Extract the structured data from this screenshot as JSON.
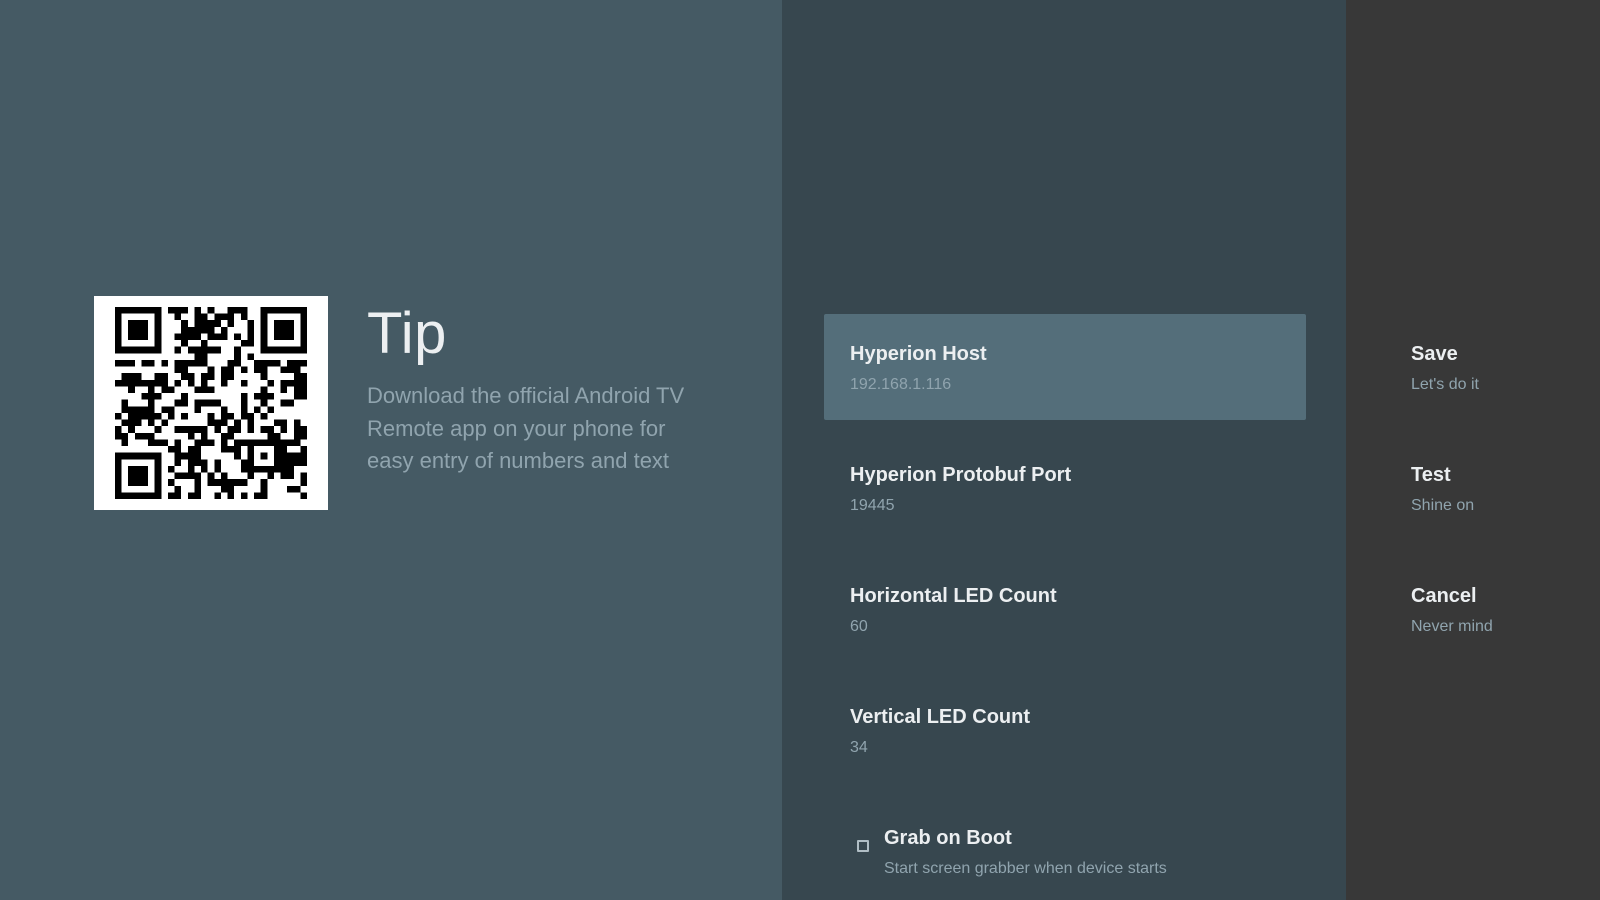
{
  "guidance": {
    "qr_icon": "qr-code-icon",
    "title": "Tip",
    "description": "Download the official Android TV Remote app on your phone for easy entry of numbers and text"
  },
  "actions": [
    {
      "title": "Hyperion Host",
      "value": "192.168.1.116",
      "focused": true
    },
    {
      "title": "Hyperion Protobuf Port",
      "value": "19445"
    },
    {
      "title": "Horizontal LED Count",
      "value": "60"
    },
    {
      "title": "Vertical LED Count",
      "value": "34"
    },
    {
      "title": "Grab on Boot",
      "description": "Start screen grabber when device starts",
      "checked": false
    }
  ],
  "buttons": [
    {
      "title": "Save",
      "description": "Let's do it"
    },
    {
      "title": "Test",
      "description": "Shine on"
    },
    {
      "title": "Cancel",
      "description": "Never mind"
    }
  ],
  "colors": {
    "guidance_bg": "#455a64",
    "actions_bg": "#37474f",
    "buttons_bg": "#383838",
    "focused_item": "#546e7a"
  }
}
